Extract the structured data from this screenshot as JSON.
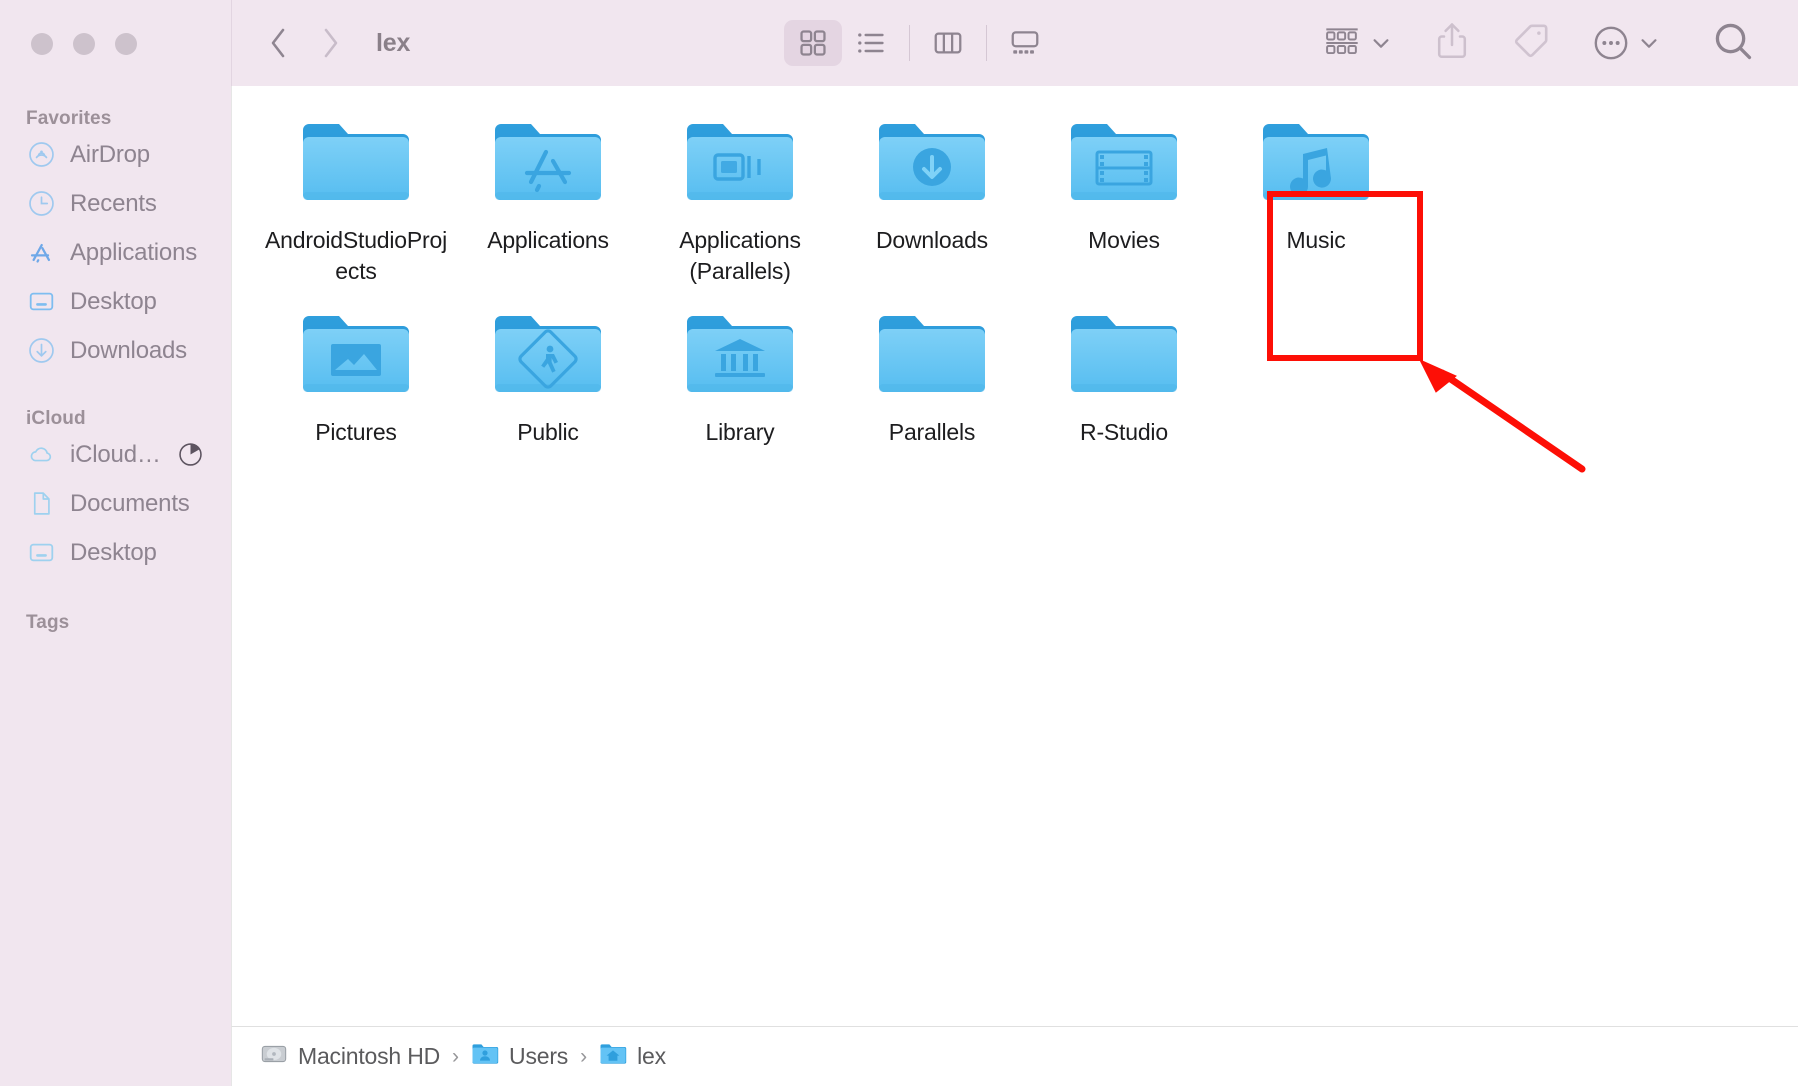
{
  "window": {
    "title": "lex",
    "traffic_lights": [
      "close",
      "minimize",
      "zoom"
    ]
  },
  "toolbar": {
    "back_label": "Back",
    "forward_label": "Forward",
    "view_modes": [
      {
        "name": "icon-view",
        "label": "Icon View",
        "active": true
      },
      {
        "name": "list-view",
        "label": "List View",
        "active": false
      },
      {
        "name": "column-view",
        "label": "Column View",
        "active": false
      },
      {
        "name": "gallery-view",
        "label": "Gallery View",
        "active": false
      }
    ],
    "group_label": "Group",
    "share_label": "Share",
    "tags_label": "Tags",
    "more_label": "More",
    "search_label": "Search"
  },
  "sidebar": {
    "sections": [
      {
        "title": "Favorites",
        "items": [
          {
            "label": "AirDrop",
            "icon": "airdrop-icon"
          },
          {
            "label": "Recents",
            "icon": "clock-icon"
          },
          {
            "label": "Applications",
            "icon": "appstore-icon"
          },
          {
            "label": "Desktop",
            "icon": "desktop-icon"
          },
          {
            "label": "Downloads",
            "icon": "download-icon"
          }
        ]
      },
      {
        "title": "iCloud",
        "items": [
          {
            "label": "iCloud…",
            "icon": "cloud-icon",
            "badge": "sync-progress-icon"
          },
          {
            "label": "Documents",
            "icon": "document-icon"
          },
          {
            "label": "Desktop",
            "icon": "desktop-icon"
          }
        ]
      },
      {
        "title": "Tags",
        "items": []
      }
    ]
  },
  "files": [
    {
      "name": "AndroidStudioProjects",
      "icon": "plain-folder-icon",
      "row": 1
    },
    {
      "name": "Applications",
      "icon": "appstore-folder-icon",
      "row": 1
    },
    {
      "name": "Applications (Parallels)",
      "icon": "parallels-folder-icon",
      "row": 1
    },
    {
      "name": "Downloads",
      "icon": "downloads-folder-icon",
      "row": 1
    },
    {
      "name": "Movies",
      "icon": "movies-folder-icon",
      "row": 1,
      "highlighted": true
    },
    {
      "name": "Music",
      "icon": "music-folder-icon",
      "row": 1
    },
    {
      "name": "Pictures",
      "icon": "pictures-folder-icon",
      "row": 2
    },
    {
      "name": "Public",
      "icon": "public-folder-icon",
      "row": 2
    },
    {
      "name": "Library",
      "icon": "library-folder-icon",
      "row": 2
    },
    {
      "name": "Parallels",
      "icon": "plain-folder-icon",
      "row": 2
    },
    {
      "name": "R-Studio",
      "icon": "plain-folder-icon",
      "row": 2
    }
  ],
  "pathbar": {
    "segments": [
      {
        "label": "Macintosh HD",
        "icon": "harddisk-icon"
      },
      {
        "label": "Users",
        "icon": "users-folder-icon"
      },
      {
        "label": "lex",
        "icon": "home-folder-icon"
      }
    ],
    "separator": "›"
  },
  "annotation": {
    "highlight_color": "#fd0f06",
    "target": "Movies"
  },
  "colors": {
    "sidebar_bg": "#f1e6ef",
    "toolbar_bg": "#f1e6ef",
    "content_bg": "#ffffff",
    "folder_blue": "#63c3f5",
    "folder_tab": "#2d9bd6",
    "annotation_red": "#fd0f06"
  }
}
